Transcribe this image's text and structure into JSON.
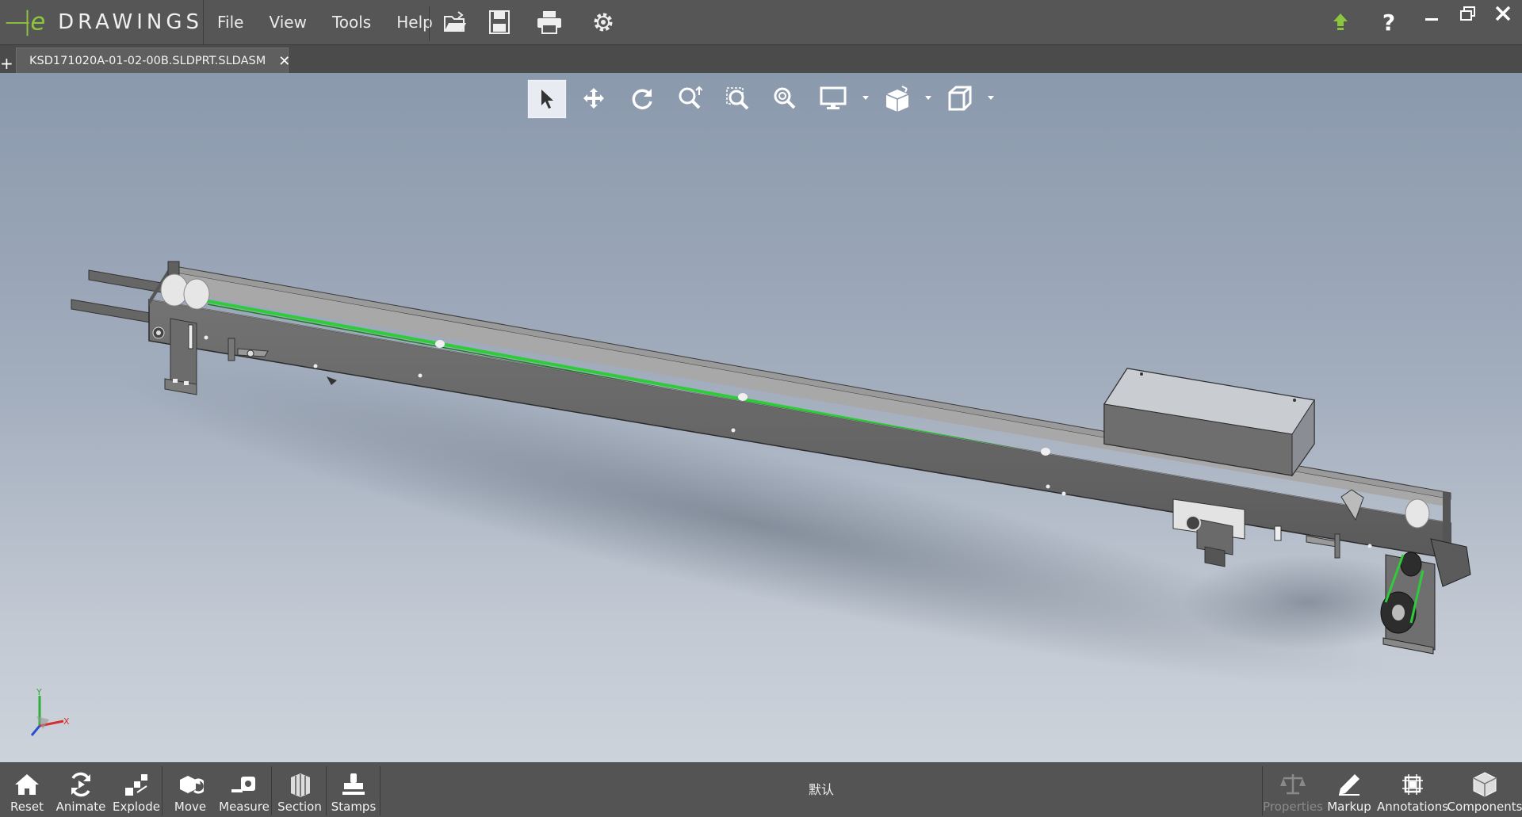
{
  "app": {
    "brand": "DRAWINGS",
    "brand_prefix": "e"
  },
  "menu": {
    "items": [
      "File",
      "View",
      "Tools",
      "Help"
    ]
  },
  "quick_access": [
    "open-icon",
    "save-icon",
    "print-icon",
    "settings-icon"
  ],
  "window": {
    "update_icon": "update-arrow-icon",
    "help": "?"
  },
  "tabs": {
    "new_tab": "+",
    "active": {
      "label": "KSD171020A-01-02-00B.SLDPRT.SLDASM",
      "close": "✕"
    }
  },
  "view_toolbar": [
    "select",
    "pan",
    "rotate",
    "zoom-to-fit",
    "zoom-to-area",
    "zoom",
    "display-style",
    "view-orientation",
    "standard-views"
  ],
  "triad": {
    "x": "X",
    "y": "Y"
  },
  "bottom_tools": {
    "reset": "Reset",
    "animate": "Animate",
    "explode": "Explode",
    "move": "Move",
    "measure": "Measure",
    "section": "Section",
    "stamps": "Stamps",
    "configuration": "默认",
    "properties": "Properties",
    "markup": "Markup",
    "annotations": "Annotations",
    "components": "Components"
  },
  "colors": {
    "belt": "#2fcc3a",
    "frame": "#6a6a6a",
    "accent": "#7ab648"
  }
}
